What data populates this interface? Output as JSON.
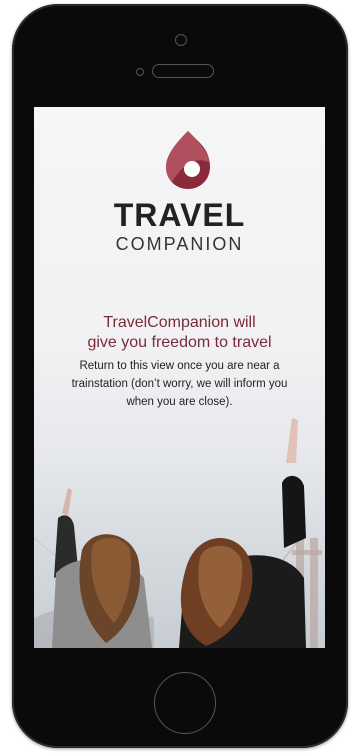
{
  "brand": {
    "title": "TRAVEL",
    "subtitle": "COMPANION",
    "accent": "#8b2a3b"
  },
  "onboarding": {
    "headline_line1": "TravelCompanion will",
    "headline_line2": "give you freedom to travel",
    "description_line1": "Return to this view once you are near a",
    "description_line2": "trainstation (don’t worry, we will inform you",
    "description_line3": "when you are close)."
  }
}
